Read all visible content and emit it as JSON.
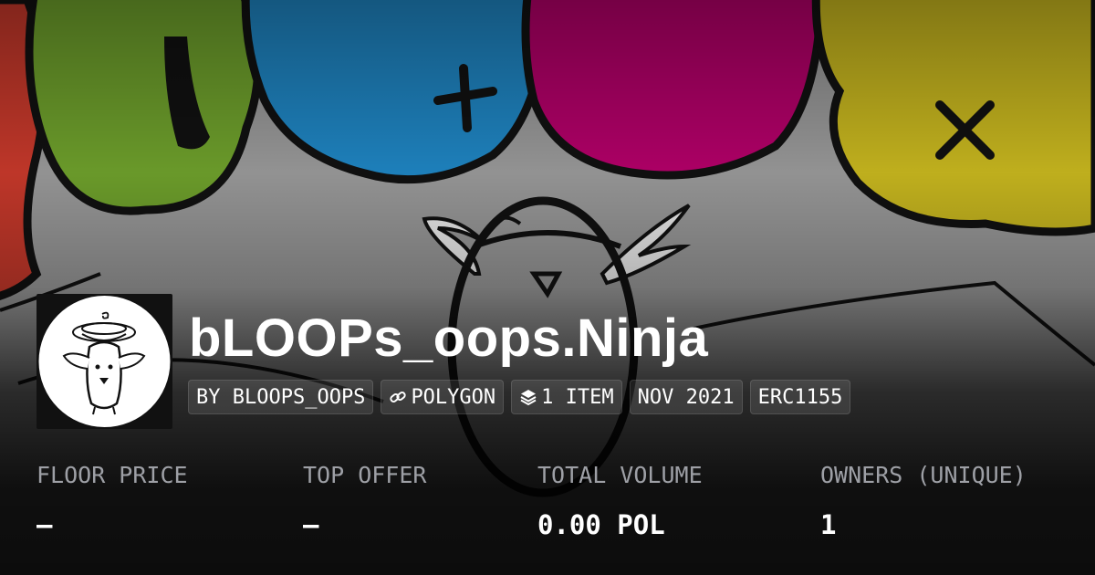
{
  "collection": {
    "name": "bLOOPs_oops.Ninja",
    "avatar_icon": "ninja-owl-logo"
  },
  "tags": {
    "creator": "BY BLOOPS_OOPS",
    "chain": "POLYGON",
    "chain_icon": "link-icon",
    "items": "1 ITEM",
    "items_icon": "layers-icon",
    "date": "NOV 2021",
    "standard": "ERC1155"
  },
  "stats": {
    "floor_price": {
      "label": "FLOOR PRICE",
      "value": "–"
    },
    "top_offer": {
      "label": "TOP OFFER",
      "value": "–"
    },
    "total_volume": {
      "label": "TOTAL VOLUME",
      "value": "0.00 POL"
    },
    "owners": {
      "label": "OWNERS (UNIQUE)",
      "value": "1"
    }
  },
  "colors": {
    "balloon_red": "#c8392b",
    "balloon_green": "#6fa12c",
    "balloon_blue": "#1f86c4",
    "balloon_magenta": "#b5006a",
    "balloon_yellow": "#c9b81f",
    "label_gray": "#9ea0a6"
  }
}
